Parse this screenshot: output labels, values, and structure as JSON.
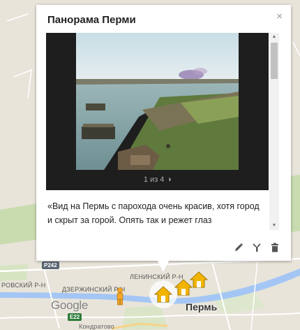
{
  "infowindow": {
    "title": "Панорама Перми",
    "close_symbol": "×",
    "pager_text": "1 из 4",
    "next_symbol": "›",
    "description": "«Вид на Пермь с парохода очень красив, хотя город и скрыт за горой. Опять так и режет глаз административная сеть… неизвестно для чего",
    "tools": [
      "edit-icon",
      "style-icon",
      "delete-icon"
    ]
  },
  "map": {
    "districts": {
      "d1": "РОВСКИЙ Р-Н",
      "d2": "ДЗЕРЖИНСКИЙ Р-Н",
      "d3": "ЛЕНИНСКИЙ Р-Н",
      "d4": "Кондратово"
    },
    "city": "Пермь",
    "road_p242": "P242",
    "road_e22": "E22",
    "logo": "Google"
  },
  "colors": {
    "marker": "#f2b400",
    "river": "#a4c6f5",
    "park": "#c9dcb0"
  }
}
